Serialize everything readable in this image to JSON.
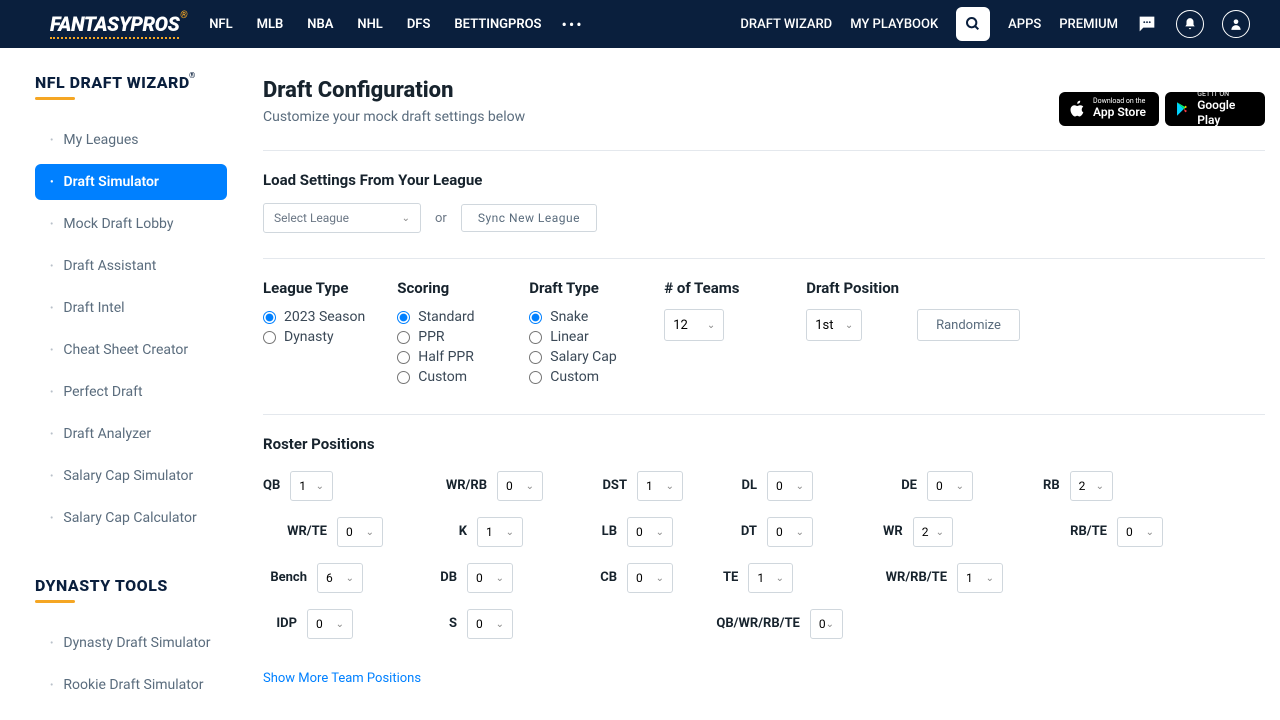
{
  "logo": {
    "fantasy": "FANTASY",
    "pros": "PROS",
    "reg": "®"
  },
  "nav": {
    "nfl": "NFL",
    "mlb": "MLB",
    "nba": "NBA",
    "nhl": "NHL",
    "dfs": "DFS",
    "betting": "BETTINGPROS"
  },
  "headerRight": {
    "wizard": "DRAFT WIZARD",
    "playbook": "MY PLAYBOOK",
    "apps": "APPS",
    "premium": "PREMIUM"
  },
  "sidebar": {
    "title1": "NFL DRAFT WIZARD",
    "reg": "®",
    "links": [
      "My Leagues",
      "Draft Simulator",
      "Mock Draft Lobby",
      "Draft Assistant",
      "Draft Intel",
      "Cheat Sheet Creator",
      "Perfect Draft",
      "Draft Analyzer",
      "Salary Cap Simulator",
      "Salary Cap Calculator"
    ],
    "title2": "DYNASTY TOOLS",
    "links2": [
      "Dynasty Draft Simulator",
      "Rookie Draft Simulator"
    ]
  },
  "main": {
    "title": "Draft Configuration",
    "sub": "Customize your mock draft settings below",
    "loadTitle": "Load Settings From Your League",
    "selectLeague": "Select League",
    "or": "or",
    "sync": "Sync New League",
    "appStore": {
      "small": "Download on the",
      "big": "App Store"
    },
    "playStore": {
      "small": "GET IT ON",
      "big": "Google Play"
    }
  },
  "config": {
    "leagueType": {
      "title": "League Type",
      "opts": [
        "2023 Season",
        "Dynasty"
      ]
    },
    "scoring": {
      "title": "Scoring",
      "opts": [
        "Standard",
        "PPR",
        "Half PPR",
        "Custom"
      ]
    },
    "draftType": {
      "title": "Draft Type",
      "opts": [
        "Snake",
        "Linear",
        "Salary Cap",
        "Custom"
      ]
    },
    "teams": {
      "title": "# of Teams",
      "value": "12"
    },
    "position": {
      "title": "Draft Position",
      "value": "1st",
      "randomize": "Randomize"
    }
  },
  "roster": {
    "title": "Roster Positions",
    "rows": [
      [
        {
          "l": "QB",
          "v": "1"
        },
        {
          "l": "WR/RB",
          "v": "0"
        },
        {
          "l": "DST",
          "v": "1"
        },
        {
          "l": "DL",
          "v": "0"
        },
        {
          "l": "DE",
          "v": "0"
        }
      ],
      [
        {
          "l": "RB",
          "v": "2"
        },
        {
          "l": "WR/TE",
          "v": "0"
        },
        {
          "l": "K",
          "v": "1"
        },
        {
          "l": "LB",
          "v": "0"
        },
        {
          "l": "DT",
          "v": "0"
        }
      ],
      [
        {
          "l": "WR",
          "v": "2"
        },
        {
          "l": "RB/TE",
          "v": "0"
        },
        {
          "l": "Bench",
          "v": "6"
        },
        {
          "l": "DB",
          "v": "0"
        },
        {
          "l": "CB",
          "v": "0"
        }
      ],
      [
        {
          "l": "TE",
          "v": "1"
        },
        {
          "l": "WR/RB/TE",
          "v": "1"
        },
        {
          "l": "",
          "v": ""
        },
        {
          "l": "IDP",
          "v": "0"
        },
        {
          "l": "S",
          "v": "0"
        }
      ],
      [
        {
          "l": "",
          "v": ""
        },
        {
          "l": "QB/WR/RB/TE",
          "v": "0"
        },
        {
          "l": "",
          "v": ""
        },
        {
          "l": "",
          "v": ""
        },
        {
          "l": "",
          "v": ""
        }
      ]
    ],
    "showMore": "Show More Team Positions"
  }
}
